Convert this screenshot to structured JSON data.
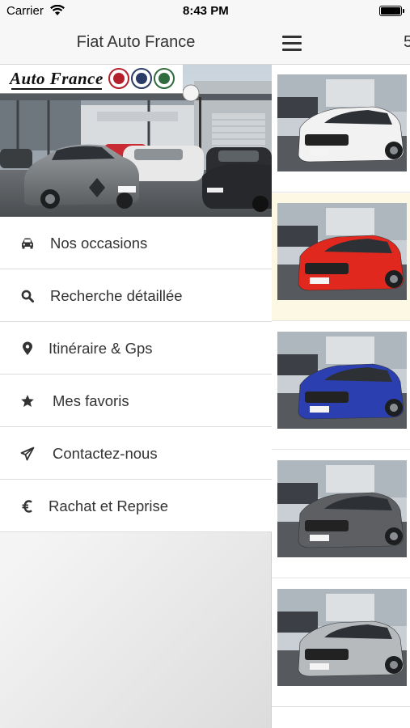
{
  "status_bar": {
    "carrier": "Carrier",
    "time": "8:43 PM"
  },
  "app": {
    "title": "Fiat Auto France"
  },
  "brand": {
    "logo_text": "Auto France",
    "badges": [
      {
        "name": "fiat-badge",
        "color": "#b3202b"
      },
      {
        "name": "lancia-badge",
        "color": "#2a3b66"
      },
      {
        "name": "alfa-romeo-badge",
        "color": "#2f6b3d"
      }
    ]
  },
  "menu": [
    {
      "label": "Nos occasions",
      "icon": "car-icon"
    },
    {
      "label": "Recherche détaillée",
      "icon": "search-icon"
    },
    {
      "label": "Itinéraire & Gps",
      "icon": "map-marker-icon"
    },
    {
      "label": "Mes favoris",
      "icon": "star-icon"
    },
    {
      "label": "Contactez-nous",
      "icon": "paper-plane-icon"
    },
    {
      "label": "Rachat et Reprise",
      "icon": "euro-icon"
    }
  ],
  "main": {
    "nav_count": "5",
    "listings": [
      {
        "car_color": "#f2f2f2",
        "highlighted": false
      },
      {
        "car_color": "#e0281e",
        "highlighted": true
      },
      {
        "car_color": "#2b3fb0",
        "highlighted": false
      },
      {
        "car_color": "#5d5f62",
        "highlighted": false
      },
      {
        "car_color": "#b7babd",
        "highlighted": false
      }
    ]
  }
}
